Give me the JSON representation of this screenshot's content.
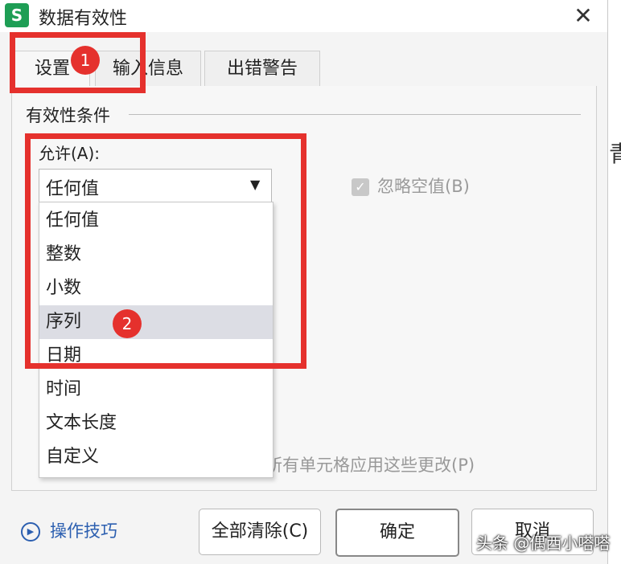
{
  "window": {
    "app_icon": "S",
    "title": "数据有效性",
    "close": "✕"
  },
  "tabs": [
    {
      "label": "设置"
    },
    {
      "label": "输入信息"
    },
    {
      "label": "出错警告"
    }
  ],
  "settings": {
    "group_label": "有效性条件",
    "allow_label": "允许(A):",
    "allow_value": "任何值",
    "ignore_blank_label": "忽略空值(B)",
    "apply_all_label": "所有单元格应用这些更改(P)"
  },
  "dropdown": {
    "options": [
      "任何值",
      "整数",
      "小数",
      "序列",
      "日期",
      "时间",
      "文本长度",
      "自定义"
    ],
    "highlighted": "序列"
  },
  "footer": {
    "tips_label": "操作技巧",
    "clear_all": "全部清除(C)",
    "ok": "确定",
    "cancel": "取消"
  },
  "annotations": {
    "badge_1": "1",
    "badge_2": "2",
    "color": "#e5312d"
  },
  "watermark": "头条 @偶西小嗒嗒",
  "background_text": "青"
}
